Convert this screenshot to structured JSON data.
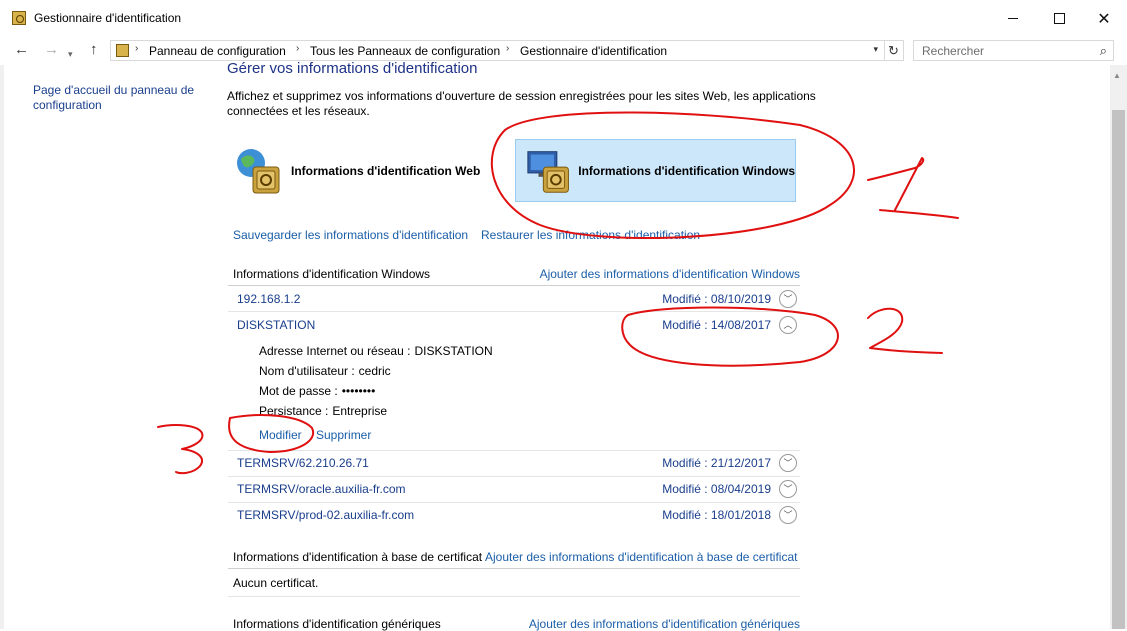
{
  "window": {
    "title": "Gestionnaire d'identification"
  },
  "address": {
    "crumbs": [
      "Panneau de configuration",
      "Tous les Panneaux de configuration",
      "Gestionnaire d'identification"
    ],
    "search_placeholder": "Rechercher"
  },
  "sidebar": {
    "home_link": "Page d'accueil du panneau de configuration"
  },
  "main": {
    "heading": "Gérer vos informations d'identification",
    "description": "Affichez et supprimez vos informations d'ouverture de session enregistrées pour les sites Web, les applications connectées et les réseaux.",
    "tiles": {
      "web": "Informations d'identification Web",
      "windows": "Informations d'identification Windows"
    },
    "backup_link": "Sauvegarder les informations d'identification",
    "restore_link": "Restaurer les informations d'identification",
    "windows_section": {
      "title": "Informations d'identification Windows",
      "add": "Ajouter des informations d'identification Windows",
      "items": [
        {
          "name": "192.168.1.2",
          "modified": "Modifié : 08/10/2019"
        },
        {
          "name": "DISKSTATION",
          "modified": "Modifié : 14/08/2017"
        },
        {
          "name": "TERMSRV/62.210.26.71",
          "modified": "Modifié : 21/12/2017"
        },
        {
          "name": "TERMSRV/oracle.auxilia-fr.com",
          "modified": "Modifié : 08/04/2019"
        },
        {
          "name": "TERMSRV/prod-02.auxilia-fr.com",
          "modified": "Modifié : 18/01/2018"
        }
      ],
      "expanded": {
        "address_label": "Adresse Internet ou réseau :",
        "address_value": "DISKSTATION",
        "user_label": "Nom d'utilisateur :",
        "user_value": "cedric",
        "password_label": "Mot de passe :",
        "password_value": "••••••••",
        "persistence_label": "Persistance :",
        "persistence_value": "Entreprise",
        "edit": "Modifier",
        "delete": "Supprimer"
      }
    },
    "certificate_section": {
      "title": "Informations d'identification à base de certificat",
      "add": "Ajouter des informations d'identification à base de certificat",
      "empty": "Aucun certificat."
    },
    "generic_section": {
      "title": "Informations d'identification génériques",
      "add": "Ajouter des informations d'identification génériques"
    }
  }
}
